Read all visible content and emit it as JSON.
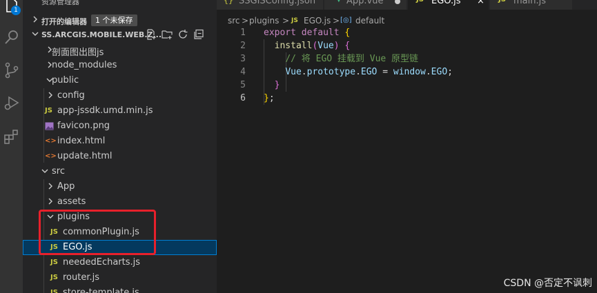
{
  "sidebar": {
    "title": "资源管理器",
    "open_editors": {
      "label": "打开的编辑器",
      "unsaved": "1 个未保存"
    },
    "project": {
      "label": "SS.ARCGIS.MOBILE.WEB.Z..."
    },
    "tree": [
      {
        "label": "剖面图出图js",
        "type": "folder",
        "expanded": false,
        "depth": 0
      },
      {
        "label": "node_modules",
        "type": "folder",
        "expanded": false,
        "depth": 0
      },
      {
        "label": "public",
        "type": "folder",
        "expanded": true,
        "depth": 0
      },
      {
        "label": "config",
        "type": "folder",
        "expanded": false,
        "depth": 1
      },
      {
        "label": "app-jssdk.umd.min.js",
        "type": "js",
        "depth": 1
      },
      {
        "label": "favicon.png",
        "type": "image",
        "depth": 1
      },
      {
        "label": "index.html",
        "type": "html",
        "depth": 1
      },
      {
        "label": "update.html",
        "type": "html",
        "depth": 1
      },
      {
        "label": "src",
        "type": "folder",
        "expanded": true,
        "depth": 0
      },
      {
        "label": "App",
        "type": "folder",
        "expanded": false,
        "depth": 1
      },
      {
        "label": "assets",
        "type": "folder",
        "expanded": false,
        "depth": 1
      },
      {
        "label": "plugins",
        "type": "folder",
        "expanded": true,
        "depth": 1
      },
      {
        "label": "commonPlugin.js",
        "type": "js",
        "depth": 2
      },
      {
        "label": "EGO.js",
        "type": "js",
        "depth": 2,
        "selected": true
      },
      {
        "label": "neededEcharts.js",
        "type": "js",
        "depth": 1
      },
      {
        "label": "router.js",
        "type": "js",
        "depth": 1
      },
      {
        "label": "store-template.js",
        "type": "js",
        "depth": 1
      }
    ]
  },
  "icons": {
    "js": "JS",
    "html": "<>",
    "activity_badge": "1"
  },
  "tabs": [
    {
      "label": "SSGISConfig.json",
      "icon": "{}"
    },
    {
      "label": "App.vue",
      "icon": "▼",
      "modified": true
    },
    {
      "label": "EGO.js",
      "icon": "JS",
      "active": true
    },
    {
      "label": "main.js",
      "icon": "JS"
    }
  ],
  "breadcrumb": {
    "part1": "src",
    "sep": ">",
    "part2": "plugins",
    "part3": "EGO.js",
    "part4": "default",
    "js_icon": "JS",
    "symbol_icon": "[◎]"
  },
  "code": {
    "line_numbers": [
      "1",
      "2",
      "3",
      "4",
      "5",
      "6"
    ],
    "l1_kw1": "export",
    "l1_kw2": "default",
    "l1_brace": "{",
    "l2_fn": "install",
    "l2_paren_open": "(",
    "l2_param": "Vue",
    "l2_paren_close": ")",
    "l2_brace": "{",
    "l3_comment": "// 将 EGO 挂载到 Vue 原型链",
    "l4_vue": "Vue",
    "l4_dot1": ".",
    "l4_prototype": "prototype",
    "l4_dot2": ".",
    "l4_ego": "EGO",
    "l4_eq": " = ",
    "l4_window": "window",
    "l4_dot3": ".",
    "l4_ego2": "EGO",
    "l4_semi": ";",
    "l5_brace": "}",
    "l6_brace": "}",
    "l6_semi": ";"
  },
  "watermark": "CSDN @否定不讽刺",
  "colors": {
    "selection": "#04395e",
    "highlight_box": "#e8202b",
    "js_icon": "#cbcb41",
    "html_icon": "#e37933"
  }
}
